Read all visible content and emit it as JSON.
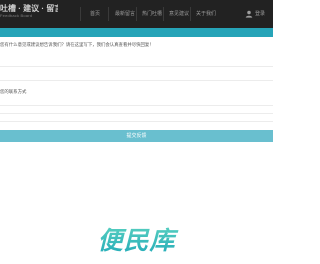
{
  "header": {
    "logo_title": "吐槽 · 建议 · 留言",
    "logo_subtitle": "Feedback Board",
    "nav_items": [
      "首页",
      "最新留言",
      "热门吐槽",
      "意见建议",
      "关于我们"
    ],
    "user_label": "登录",
    "icon": "user-icon"
  },
  "form": {
    "feedback_prompt": "您有什么意见或建议想告诉我们？请在这里写下，我们会认真查看并尽快回复！",
    "feedback_value": "",
    "contact_label": "您的联系方式",
    "contact_value": "",
    "submit_label": "提交反馈"
  },
  "brand": {
    "text": "便民库"
  },
  "colors": {
    "topbar": "#222222",
    "accent": "#26a4b8",
    "button": "#69bfcf",
    "brand": "#35c0b4"
  }
}
